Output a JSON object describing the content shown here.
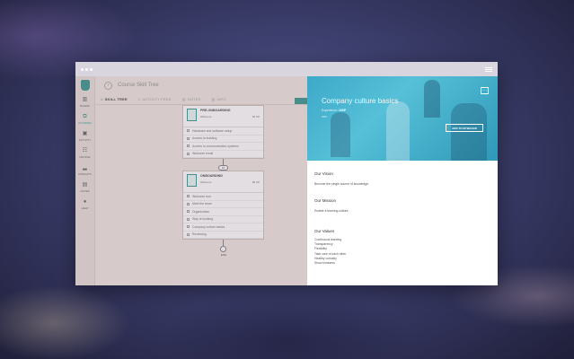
{
  "window": {
    "title": ""
  },
  "sidebar": {
    "items": [
      {
        "label": "BOARD",
        "icon": "board-icon",
        "glyph": "▥"
      },
      {
        "label": "COURSES",
        "icon": "courses-icon",
        "glyph": "⧉"
      },
      {
        "label": "ACTIVITY",
        "icon": "activity-icon",
        "glyph": "▣"
      },
      {
        "label": "PEOPLE",
        "icon": "people-icon",
        "glyph": "☷"
      },
      {
        "label": "INSIGHTS",
        "icon": "insights-icon",
        "glyph": "▂"
      },
      {
        "label": "NOTES",
        "icon": "notes-icon",
        "glyph": "▤"
      },
      {
        "label": "HELP",
        "icon": "help-icon",
        "glyph": "●"
      }
    ]
  },
  "header": {
    "back_glyph": "‹",
    "title": "Course Skill Tree"
  },
  "tabs": [
    {
      "label": "SKILL TREE",
      "glyph": "⌂"
    },
    {
      "label": "ACTIVITY FEED",
      "glyph": "≡"
    },
    {
      "label": "NOTES",
      "glyph": "▤"
    },
    {
      "label": "INFO",
      "glyph": "▤"
    }
  ],
  "flow": {
    "stage1": {
      "name": "PRE-ONBOARDING",
      "meta_left": "Welcome",
      "meta_right": "50 XP",
      "items": [
        "Hardware and software setup",
        "Access to building",
        "Access to communication systems",
        "Welcome email"
      ]
    },
    "connector_badge": "10",
    "stage2": {
      "name": "ONBOARDING",
      "meta_left": "Welcome",
      "meta_right": "80 XP",
      "items": [
        "Welcome tour",
        "Meet the team",
        "Organization",
        "Way of working",
        "Company culture basics",
        "Reviewing"
      ]
    },
    "end_label": "END"
  },
  "panel": {
    "title": "Company culture basics",
    "experience_label": "Experience:",
    "experience_value": "10XP",
    "xp": "XP0",
    "more_glyph": "···",
    "add_button": "ADD TO MYBOARD",
    "vision_heading": "Our Vision",
    "vision_text": "Become the single source of knowledge.",
    "mission_heading": "Our Mission",
    "mission_text": "Enable a learning culture.",
    "values_heading": "Our Values",
    "values": [
      "Continuous learning",
      "Transparency",
      "Flexibility",
      "Take care of each other",
      "Healthy curiosity",
      "Show kindness"
    ]
  },
  "colors": {
    "accent": "#2a8f86",
    "hero": "#3ea9c8"
  }
}
